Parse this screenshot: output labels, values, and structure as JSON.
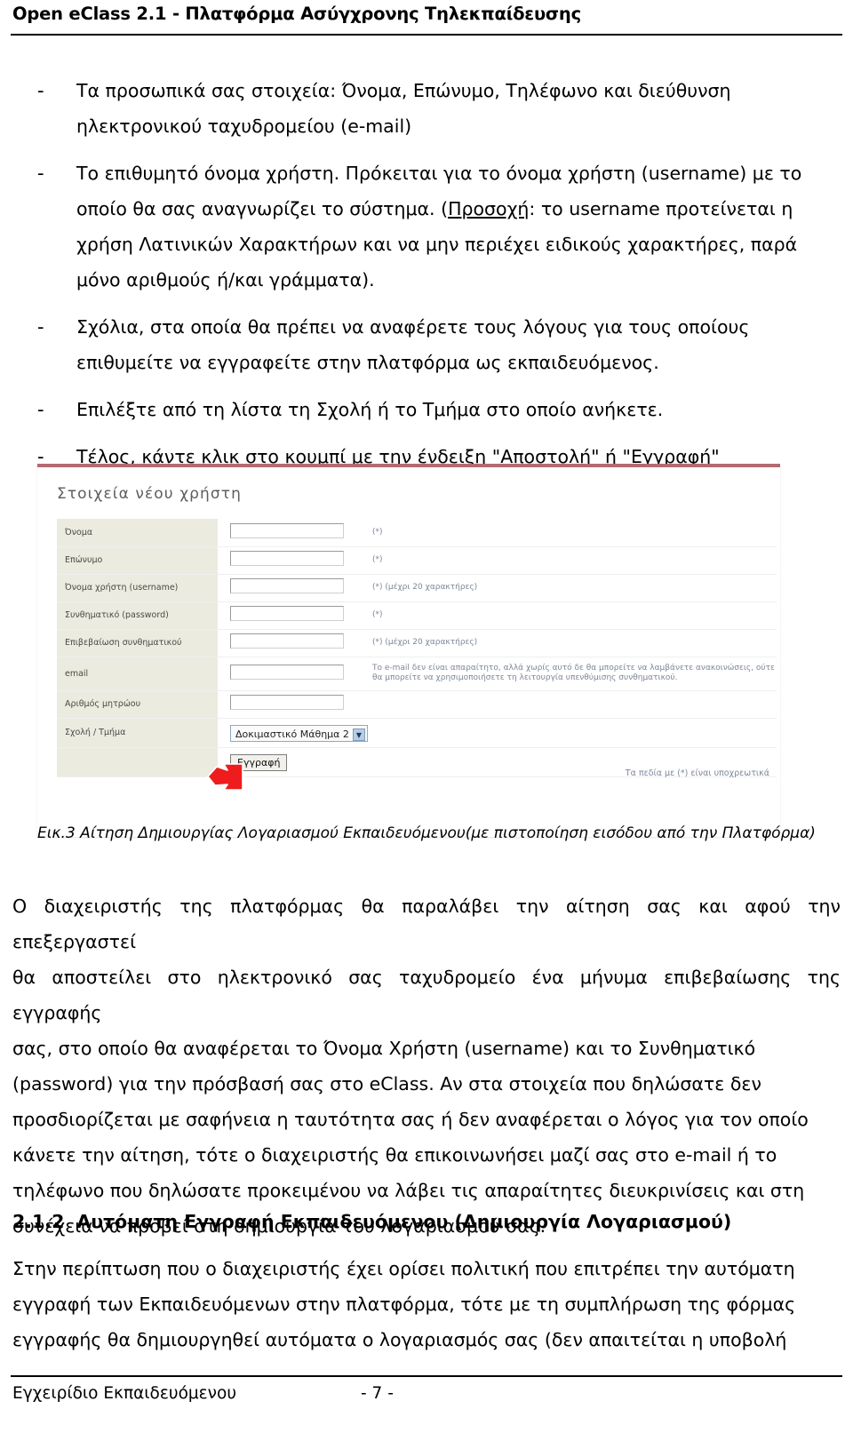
{
  "header": {
    "title": "Open eClass 2.1 - Πλατφόρμα Ασύγχρονης Τηλεκπαίδευσης"
  },
  "bullets": [
    {
      "marker": "-",
      "lines": [
        "Τα προσωπικά σας στοιχεία: Όνομα, Επώνυμο, Τηλέφωνο και διεύθυνση",
        "ηλεκτρονικού ταχυδρομείου (e-mail)"
      ]
    },
    {
      "marker": "-",
      "lines": [
        "Το επιθυμητό όνομα χρήστη. Πρόκειται για το όνομα χρήστη (username) με το",
        "οποίο θα σας αναγνωρίζει το σύστημα. (Προσοχή: το username προτείνεται η",
        "χρήση Λατινικών Χαρακτήρων και να μην περιέχει ειδικούς χαρακτήρες, παρά",
        "μόνο αριθμούς ή/και γράμματα)."
      ],
      "underlined_word": "Προσοχή"
    },
    {
      "marker": "-",
      "lines": [
        "Σχόλια, στα οποία θα πρέπει να αναφέρετε τους λόγους για τους οποίους",
        "επιθυμείτε να εγγραφείτε στην πλατφόρμα ως εκπαιδευόμενος."
      ]
    },
    {
      "marker": "-",
      "lines": [
        "Επιλέξτε από τη λίστα τη Σχολή ή το Τμήμα στο οποίο ανήκετε."
      ]
    },
    {
      "marker": "-",
      "lines": [
        "Τέλος, κάντε κλικ στο κουμπί με την ένδειξη \"Αποστολή\" ή \"Εγγραφή\""
      ]
    }
  ],
  "screenshot": {
    "accent_color": "#b36b72",
    "label_bg": "#ecebe0",
    "hint_color": "#7d8698",
    "form_title": "Στοιχεία νέου χρήστη",
    "rows": [
      {
        "label": "Όνομα",
        "control": "text",
        "value": "",
        "hint": "(*)"
      },
      {
        "label": "Επώνυμο",
        "control": "text",
        "value": "",
        "hint": "(*)"
      },
      {
        "label": "Όνομα χρήστη (username)",
        "control": "text",
        "value": "",
        "hint": "(*) (μέχρι 20 χαρακτήρες)"
      },
      {
        "label": "Συνθηματικό (password)",
        "control": "text",
        "value": "",
        "hint": "(*)"
      },
      {
        "label": "Επιβεβαίωση συνθηματικού",
        "control": "text",
        "value": "",
        "hint": "(*) (μέχρι 20 χαρακτήρες)"
      },
      {
        "label": "email",
        "control": "text",
        "value": "",
        "hint": "Το e-mail δεν είναι απαραίτητο, αλλά χωρίς αυτό δε θα μπορείτε να λαμβάνετε ανακοινώσεις, ούτε θα μπορείτε να χρησιμοποιήσετε τη λειτουργία υπενθύμισης συνθηματικού."
      },
      {
        "label": "Αριθμός μητρώου",
        "control": "text",
        "value": "",
        "hint": ""
      },
      {
        "label": "Σχολή / Τμήμα",
        "control": "select",
        "value": "Δοκιμαστικό Μάθημα 2",
        "hint": ""
      },
      {
        "label": "",
        "control": "button",
        "value": "Εγγραφή",
        "hint": ""
      }
    ],
    "submit_label": "Εγγραφή",
    "select_value": "Δοκιμαστικό Μάθημα 2",
    "required_note": "Τα πεδία με (*) είναι υποχρεωτικά",
    "cursor": "mouse-pointer-arrow"
  },
  "caption": "Εικ.3 Αίτηση Δημιουργίας Λογαριασμού Εκπαιδευόμενου(με πιστοποίηση εισόδου από την Πλατφόρμα)",
  "paragraph1": {
    "lines": [
      "Ο διαχειριστής της πλατφόρμας θα παραλάβει την αίτηση σας και αφού την επεξεργαστεί",
      "θα αποστείλει στο ηλεκτρονικό σας ταχυδρομείο ένα μήνυμα επιβεβαίωσης της εγγραφής",
      "σας, στο οποίο θα αναφέρεται το Όνομα Χρήστη (username) και το Συνθηματικό",
      "(password) για την πρόσβασή σας στο eClass. Αν στα στοιχεία που δηλώσατε δεν",
      "προσδιορίζεται με σαφήνεια η ταυτότητα σας ή δεν αναφέρεται ο λόγος για τον οποίο",
      "κάνετε την αίτηση, τότε ο διαχειριστής θα επικοινωνήσει μαζί σας στο e-mail ή το",
      "τηλέφωνο που δηλώσατε προκειμένου να λάβει τις απαραίτητες διευκρινίσεις και στη",
      "συνέχεια να προβεί στη δημιουργία του λογαριασμού σας."
    ]
  },
  "section": {
    "number": "2.1.2",
    "title": "Αυτόματη Εγγραφή Εκπαιδευόμενου (Δημιουργία Λογαριασμού)"
  },
  "paragraph2": {
    "lines": [
      "Στην περίπτωση που ο διαχειριστής έχει ορίσει πολιτική που επιτρέπει την αυτόματη",
      "εγγραφή των Εκπαιδευόμενων στην πλατφόρμα, τότε με τη συμπλήρωση της φόρμας",
      "εγγραφής θα δημιουργηθεί αυτόματα ο λογαριασμός σας (δεν απαιτείται η υποβολή"
    ]
  },
  "footer": {
    "left": "Εγχειρίδιο Εκπαιδευόμενου",
    "page": "- 7 -"
  }
}
